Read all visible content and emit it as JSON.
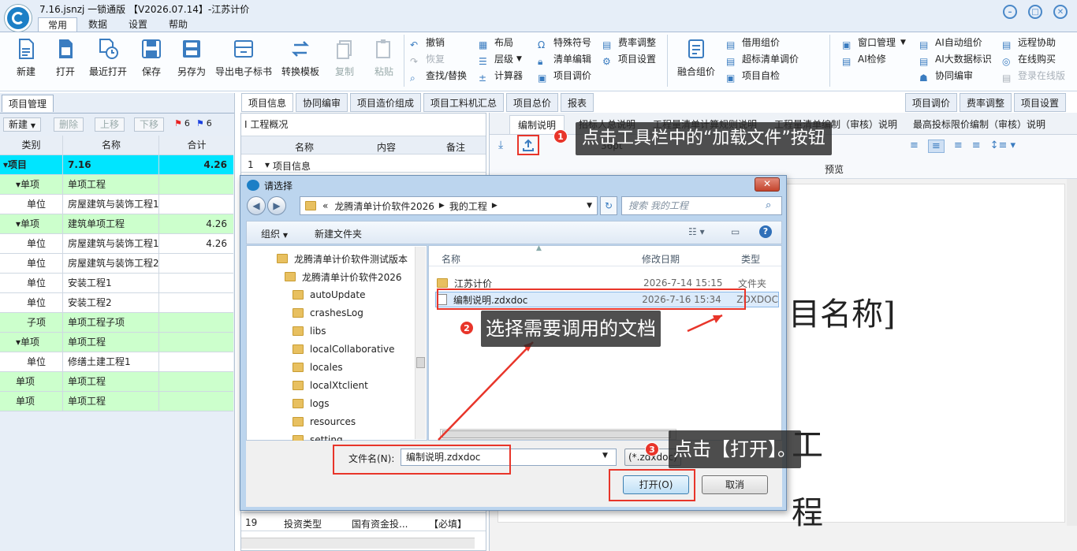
{
  "app": {
    "window_title": "7.16.jsnzj 一锁通版 【V2026.07.14】-江苏计价",
    "menu_tabs": [
      "常用",
      "数据",
      "设置",
      "帮助"
    ]
  },
  "ribbon": {
    "big_buttons": [
      "新建",
      "打开",
      "最近打开",
      "保存",
      "另存为",
      "导出电子标书",
      "转换模板",
      "复制",
      "粘贴"
    ],
    "group1": [
      "撤销",
      "恢复",
      "查找/替换"
    ],
    "group2": [
      "布局",
      "层级",
      "计算器"
    ],
    "group3": [
      "特殊符号",
      "清单编辑",
      "项目调价"
    ],
    "group4": [
      "费率调整",
      "项目设置"
    ],
    "fuse_button": "融合组价",
    "group5": [
      "借用组价",
      "超标清单调价",
      "项目自检"
    ],
    "group6": [
      "窗口管理",
      "AI检修"
    ],
    "group7": [
      "AI自动组价",
      "AI大数据标识",
      "协同编审"
    ],
    "group8": [
      "远程协助",
      "在线购买",
      "登录在线版"
    ]
  },
  "left_panel": {
    "tab": "项目管理",
    "toolbar": {
      "new": "新建",
      "delete": "删除",
      "up": "上移",
      "down": "下移",
      "red_flag_count": "6",
      "blue_flag_count": "6"
    },
    "columns": [
      "类别",
      "名称",
      "合计"
    ],
    "rows": [
      {
        "type": "项目",
        "name": "7.16",
        "total": "4.26"
      },
      {
        "type": "单项",
        "name": "单项工程",
        "total": ""
      },
      {
        "type": "单位",
        "name": "房屋建筑与装饰工程1",
        "total": ""
      },
      {
        "type": "单项",
        "name": "建筑单项工程",
        "total": "4.26"
      },
      {
        "type": "单位",
        "name": "房屋建筑与装饰工程1",
        "total": "4.26"
      },
      {
        "type": "单位",
        "name": "房屋建筑与装饰工程2",
        "total": ""
      },
      {
        "type": "单位",
        "name": "安装工程1",
        "total": ""
      },
      {
        "type": "单位",
        "name": "安装工程2",
        "total": ""
      },
      {
        "type": "子项",
        "name": "单项工程子项",
        "total": ""
      },
      {
        "type": "单项",
        "name": "单项工程",
        "total": ""
      },
      {
        "type": "单位",
        "name": "修缮土建工程1",
        "total": ""
      },
      {
        "type": "单项",
        "name": "单项工程",
        "total": ""
      },
      {
        "type": "单项",
        "name": "单项工程",
        "total": ""
      }
    ]
  },
  "main_tabs": [
    "项目信息",
    "协同编审",
    "项目造价组成",
    "项目工料机汇总",
    "项目总价",
    "报表"
  ],
  "right_tabs": [
    "项目调价",
    "费率调整",
    "项目设置"
  ],
  "grid": {
    "section": "工程概况",
    "columns": [
      "名称",
      "内容",
      "备注"
    ],
    "row1": {
      "no": "1",
      "name": "项目信息"
    },
    "row19": {
      "no": "19",
      "name": "投资类型",
      "content": "国有资金投...",
      "note": "【必填】"
    }
  },
  "doc": {
    "tabs": [
      "编制说明",
      "招标人总说明",
      "工程量清单计算规则说明",
      "工程量清单编制（审核）说明",
      "最高投标限价编制（审核）说明"
    ],
    "preview": "预览",
    "font_size": "36pt",
    "big_text_1": "目名称]",
    "big_text_2": "工",
    "big_text_3": "程"
  },
  "dialog": {
    "title": "请选择",
    "path": [
      "«",
      "龙腾清单计价软件2026",
      "我的工程"
    ],
    "search_placeholder": "搜索 我的工程",
    "organize": "组织",
    "new_folder": "新建文件夹",
    "nav_items": [
      "龙腾清单计价软件测试版本",
      "龙腾清单计价软件2026",
      "autoUpdate",
      "crashesLog",
      "libs",
      "localCollaborative",
      "locales",
      "localXtclient",
      "logs",
      "resources",
      "setting"
    ],
    "file_columns": [
      "名称",
      "修改日期",
      "类型"
    ],
    "files": [
      {
        "name": "江苏计价",
        "date": "2026-7-14 15:15",
        "type": "文件夹"
      },
      {
        "name": "编制说明.zdxdoc",
        "date": "2026-7-16 15:34",
        "type": "ZDXDOC"
      }
    ],
    "filename_label": "文件名(N):",
    "filename_value": "编制说明.zdxdoc",
    "filetype": "(*.zdxdoc)",
    "open_button": "打开(O)",
    "cancel_button": "取消"
  },
  "annotations": {
    "step1_num": "1",
    "step1": "点击工具栏中的“加载文件”按钮",
    "step2_num": "2",
    "step2": "选择需要调用的文档",
    "step3_num": "3",
    "step3": "点击【打开】。"
  },
  "colors": {
    "accent": "#1c7fc6",
    "selected_row": "#00e5ff",
    "green_row": "#ccffcc",
    "annotation_red": "#e8352a"
  }
}
